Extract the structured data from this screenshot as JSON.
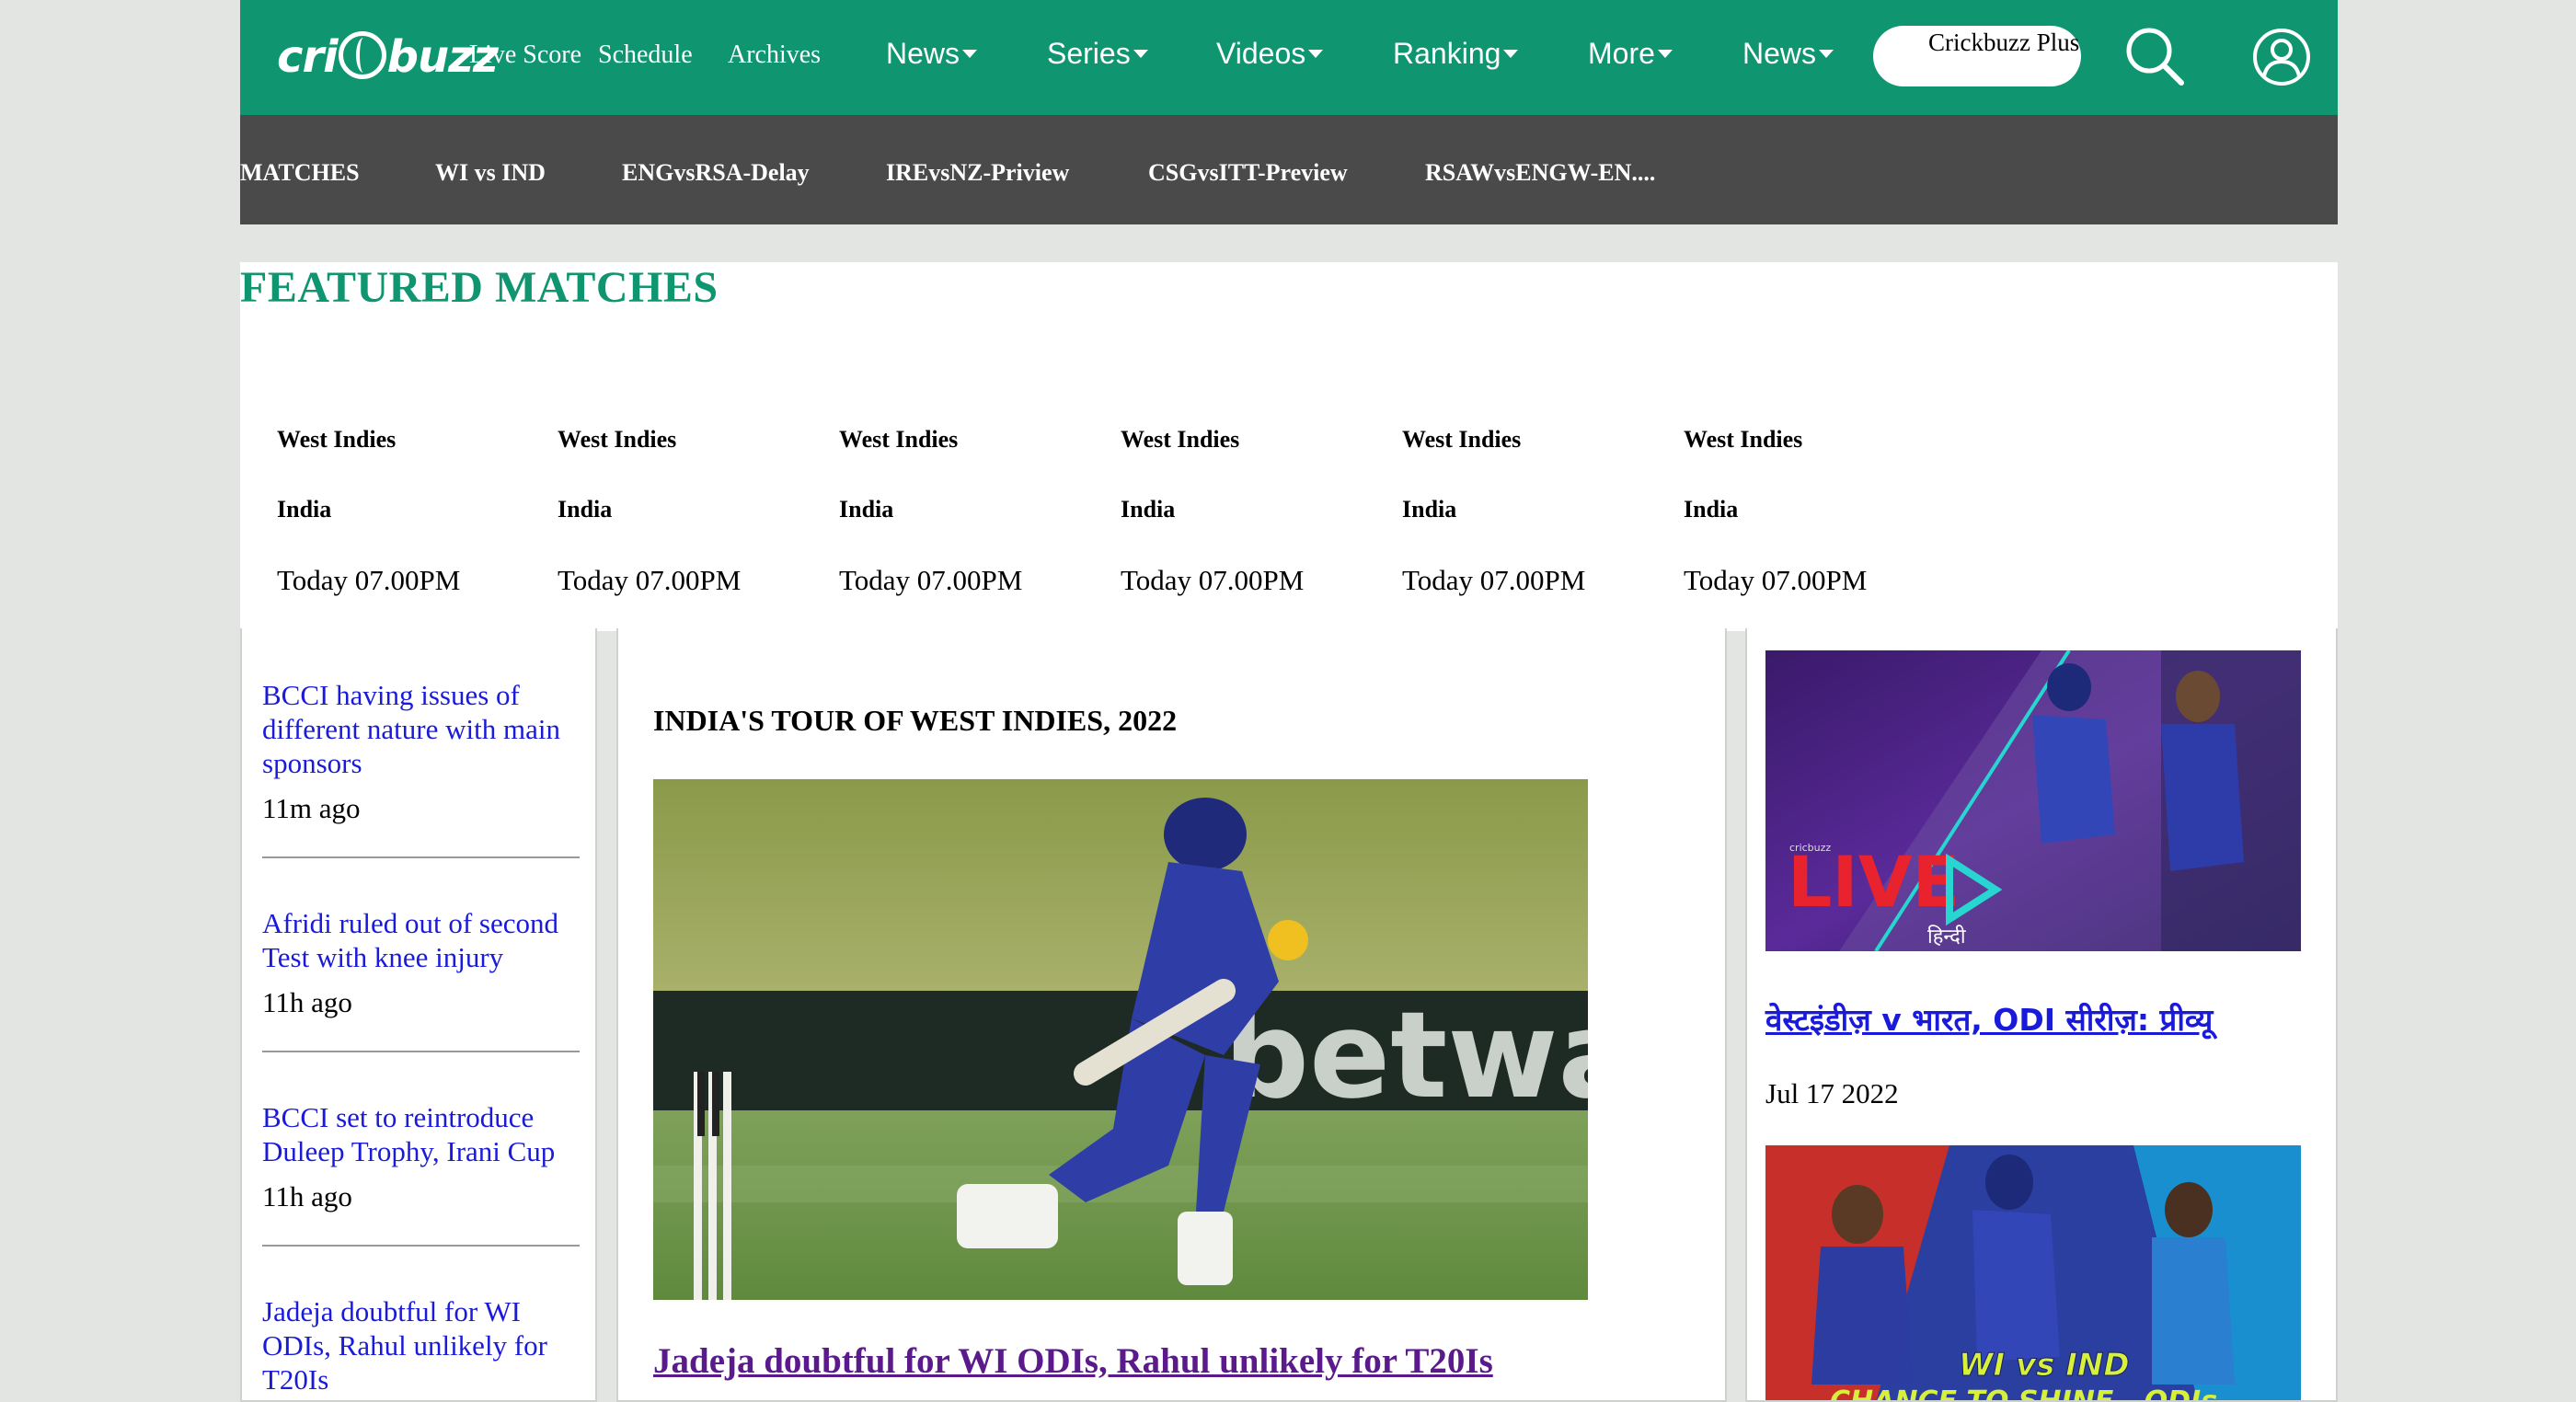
{
  "header": {
    "logo_text": "cricbuzz",
    "links_small": [
      "Live Score",
      "Schedule",
      "Archives"
    ],
    "links_menu": [
      "News",
      "Series",
      "Videos",
      "Ranking",
      "More",
      "News"
    ],
    "plus_button": "Crickbuzz Plus",
    "search_icon": "search-icon",
    "profile_icon": "user-profile-icon",
    "colors": {
      "header_bg": "#0f9670",
      "subnav_bg": "#4a4a4a",
      "link_blue": "#1a1adb",
      "visited_purple": "#5b1a8c"
    }
  },
  "subnav": {
    "items": [
      "MATCHES",
      "WI vs IND",
      "ENGvsRSA-Delay",
      "IREvsNZ-Priview",
      "CSGvsITT-Preview",
      "RSAWvsENGW-EN...."
    ]
  },
  "featured": {
    "title": "FEATURED MATCHES",
    "matches": [
      {
        "team1": "West Indies",
        "team2": "India",
        "time": "Today 07.00PM"
      },
      {
        "team1": "West Indies",
        "team2": "India",
        "time": "Today 07.00PM"
      },
      {
        "team1": "West Indies",
        "team2": "India",
        "time": "Today 07.00PM"
      },
      {
        "team1": "West Indies",
        "team2": "India",
        "time": "Today 07.00PM"
      },
      {
        "team1": "West Indies",
        "team2": "India",
        "time": "Today 07.00PM"
      },
      {
        "team1": "West Indies",
        "team2": "India",
        "time": "Today 07.00PM"
      }
    ]
  },
  "latest_news": [
    {
      "title": "BCCI having issues of different nature with main sponsors",
      "ago": "11m ago"
    },
    {
      "title": "Afridi ruled out of second Test with knee injury",
      "ago": "11h ago"
    },
    {
      "title": "BCCI set to reintroduce Duleep Trophy, Irani Cup",
      "ago": "11h ago"
    },
    {
      "title": "Jadeja doubtful for WI ODIs, Rahul unlikely for T20Is",
      "ago": ""
    }
  ],
  "main": {
    "section_title": "INDIA'S TOUR OF WEST INDIES, 2022",
    "photo_banner": "betway",
    "headline": "Jadeja doubtful for WI ODIs, Rahul unlikely for T20Is"
  },
  "videos": {
    "thumb1": {
      "live_text": "LIVE",
      "lang_text": "हिन्दी",
      "brand": "cricbuzz"
    },
    "title": "वेस्टइंडीज़ v भारत, ODI सीरीज़: प्रीव्यू",
    "date": "Jul 17 2022",
    "thumb2": {
      "caption_line1": "WI vs IND",
      "caption_line2": "CHANCE TO SHINE - ODIs"
    }
  }
}
